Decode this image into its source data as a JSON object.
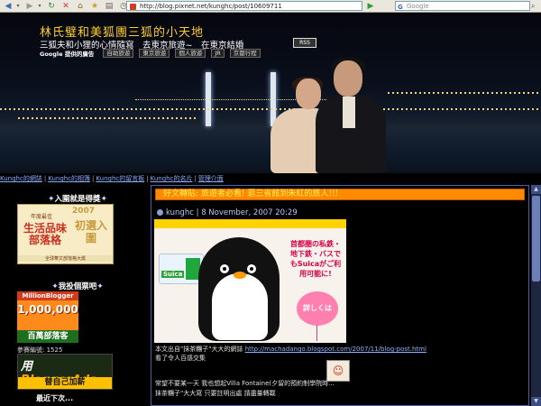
{
  "browser": {
    "url": "http://blog.pixnet.net/kunghc/post/10609711",
    "search_placeholder": "Google",
    "search_engine_label": "G",
    "go_label": "▶"
  },
  "header": {
    "title": "林氏璧和美狐團三狐的小天地",
    "subtitle": "三狐夫和小狸的心情隨寫　去東京旅遊~　在東京結婚",
    "rss_label": "RSS",
    "ads_label": "Google 提供的廣告",
    "ads": [
      "自助旅遊",
      "東京旅遊",
      "個人旅遊",
      "JR",
      "京都行程"
    ]
  },
  "nav": {
    "links": [
      "Kunghc的網誌",
      "Kunghc的相簿",
      "Kunghc的留言板",
      "Kunghc的名片",
      "管理介面"
    ]
  },
  "sidebar": {
    "award_heading": "入圍就是得獎",
    "award_badge": {
      "year": "2007",
      "left_small": "年度最佳",
      "left_big": "生活品味部落格",
      "right_big": "初選入圍",
      "foot": "全球華文部落格大獎"
    },
    "vote_heading": "我投個票吧",
    "million_badge": {
      "top": "MillionBlogger",
      "number": "1,000,000",
      "bottom": "百萬部落客"
    },
    "count_text": "參賽編號: 1525",
    "bloggerads": {
      "prefix": "用",
      "brand": "BloggerAds",
      "bottom": "替自己加薪"
    },
    "next_heading": "最近下次..."
  },
  "post": {
    "banner": "好文轉貼: 旅遊者必看! 逛三省館到朱紅的旅人!!!",
    "author": "kunghc",
    "date": "8 November, 2007 20:29",
    "promo": {
      "card_label": "Suica",
      "text": "首都圏の私鉄・地下鉄・バスでもSuicaがご利用可能に!",
      "balloon": "詳しくは"
    },
    "line1_prefix": "本文出自\"抹茶糰子\"大大的網誌",
    "line1_url": "http://machadango.blogspot.com/2007/11/blog-post.html",
    "line2": "看了令人百感交集",
    "line3": "常望不要某一天 我也想起Villa Fontaine(夕留的預約制學院時...",
    "line4": "抹茶糰子\"大大寫 只要註明出處  請盡量轉載"
  }
}
